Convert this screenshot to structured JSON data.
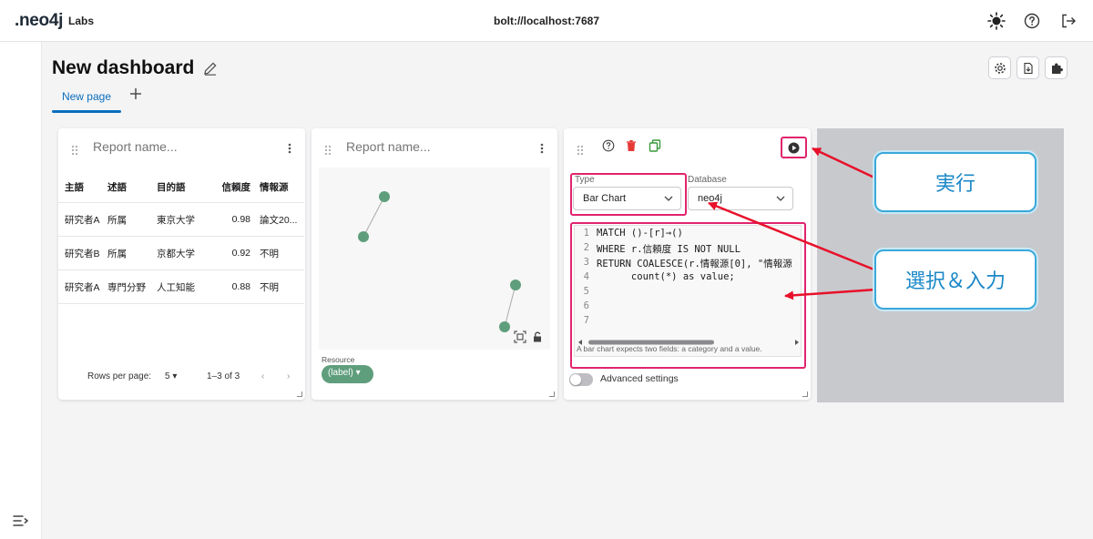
{
  "app": {
    "logo_text": ".neo4j",
    "logo_suffix": "Labs",
    "connection": "bolt://localhost:7687",
    "icons": [
      "theme-sun-icon",
      "help-icon",
      "logout-icon"
    ]
  },
  "dashboard": {
    "title": "New dashboard",
    "tabs": [
      {
        "label": "New page",
        "active": true
      }
    ],
    "header_icons": [
      "settings-icon",
      "download-icon",
      "extensions-icon"
    ]
  },
  "table_report": {
    "placeholder": "Report name...",
    "columns": [
      "主語",
      "述語",
      "目的語",
      "信頼度",
      "情報源"
    ],
    "rows": [
      [
        "研究者A",
        "所属",
        "東京大学",
        "0.98",
        "論文20..."
      ],
      [
        "研究者B",
        "所属",
        "京都大学",
        "0.92",
        "不明"
      ],
      [
        "研究者A",
        "専門分野",
        "人工知能",
        "0.88",
        "不明"
      ]
    ],
    "rows_per_page_label": "Rows per page:",
    "rows_per_page": "5",
    "page_range": "1–3 of 3"
  },
  "graph_report": {
    "placeholder": "Report name...",
    "legend_title": "Resource",
    "legend_chip": "(label)",
    "node_label": "Resource"
  },
  "editor_report": {
    "type_label": "Type",
    "type_value": "Bar Chart",
    "database_label": "Database",
    "database_value": "neo4j",
    "code_lines": [
      {
        "n": "1",
        "text": "MATCH ()-[r]→()"
      },
      {
        "n": "2",
        "text": "WHERE r.信頼度 IS NOT NULL"
      },
      {
        "n": "3",
        "text": "RETURN COALESCE(r.情報源[0], \"情報源"
      },
      {
        "n": "4",
        "text": "      count(*) as value;"
      },
      {
        "n": "5",
        "text": ""
      },
      {
        "n": "6",
        "text": ""
      },
      {
        "n": "7",
        "text": ""
      }
    ],
    "hint": "A bar chart expects two fields: a category and a value.",
    "advanced_label": "Advanced settings"
  },
  "annotations": {
    "run_label": "実行",
    "select_input_label": "選択＆入力",
    "highlight_color": "#e0246d",
    "arrow_color": "#e8102a"
  }
}
